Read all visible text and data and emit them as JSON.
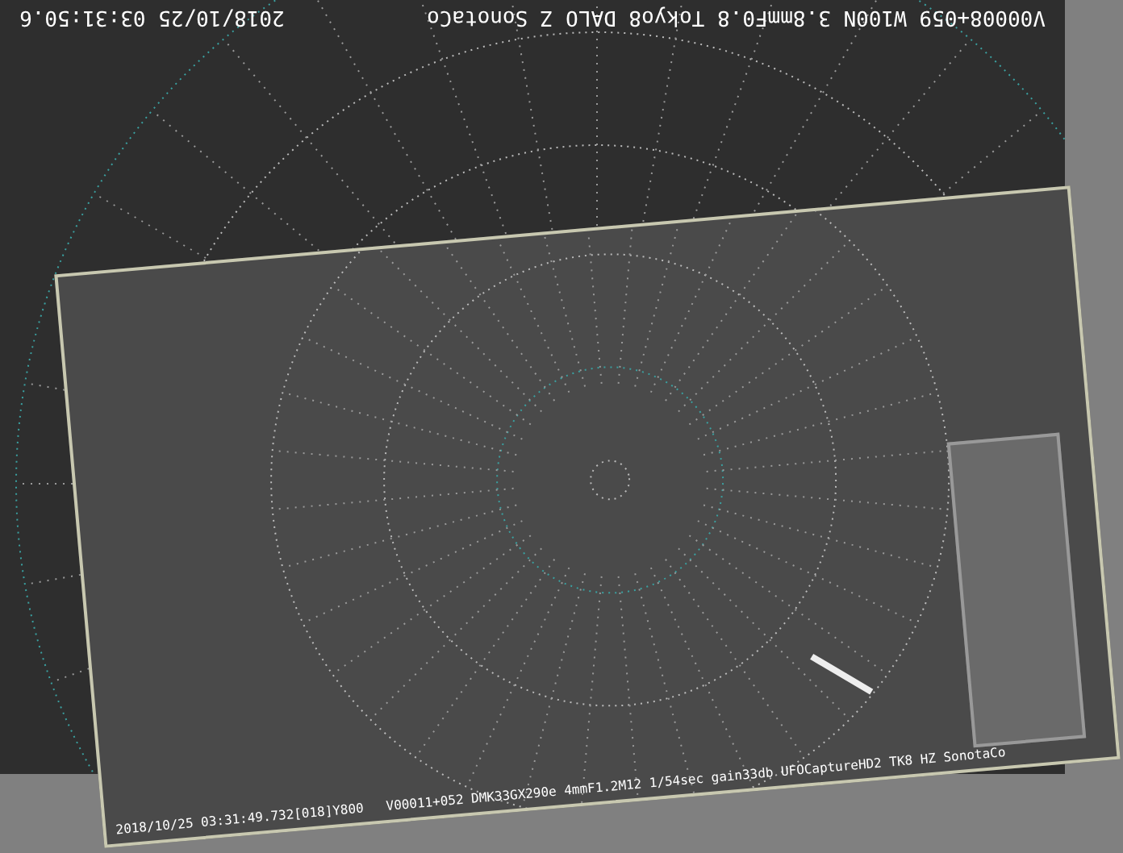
{
  "frames": [
    {
      "kind": "upside_down",
      "timestamp": "2018/10/25 03:31:50.6",
      "info": "V00008+059 W100N 3.8mmF0.8 Tokyo8 DALO Z SonotaCo"
    },
    {
      "kind": "tilted",
      "timestamp": "2018/10/25 03:31:49.732[018]Y800",
      "info": "V00011+052 DMK33GX290e 4mmF1.2M12 1/54sec gain33db UFOCaptureHD2 TK8 HZ SonotaCo"
    }
  ]
}
